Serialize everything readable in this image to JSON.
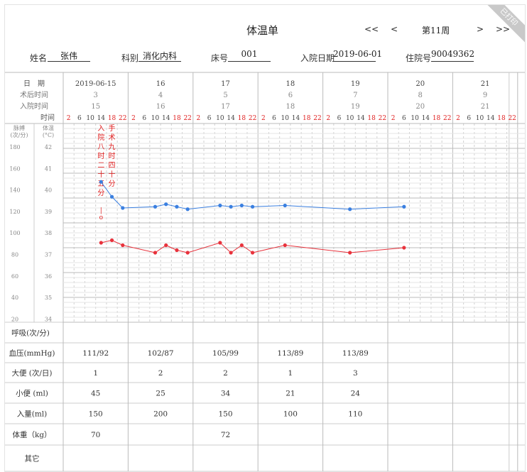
{
  "sheet_title": "体温单",
  "nav": {
    "first": "<<",
    "prev": "<",
    "week": "第11周",
    "next": ">",
    "last": ">>"
  },
  "badge": "已打印",
  "patient": {
    "name_label": "姓名",
    "name": "张伟",
    "dept_label": "科别",
    "dept": "消化内科",
    "bed_label": "床号",
    "bed": "001",
    "admit_label": "入院日期",
    "admit": "2019-06-01",
    "hosp_label": "住院号",
    "hosp": "90049362"
  },
  "row_labels": {
    "date": "日　期",
    "post_op": "术后时间",
    "admit_days": "入院时间",
    "time": "时间",
    "pulse_header": [
      "脉搏",
      "(次/分)"
    ],
    "temp_header": [
      "体温",
      "(°C)"
    ],
    "resp": "呼吸(次/分)",
    "bp": "血压(mmHg)",
    "stool": "大便 (次/日)",
    "urine": "小便 (ml)",
    "intake": "入量(ml)",
    "weight": "体重（kg）",
    "other": "其它"
  },
  "days": [
    {
      "date": "2019-06-15",
      "post_op": "3",
      "admit_day": "15"
    },
    {
      "date": "16",
      "post_op": "4",
      "admit_day": "16"
    },
    {
      "date": "17",
      "post_op": "5",
      "admit_day": "17"
    },
    {
      "date": "18",
      "post_op": "6",
      "admit_day": "18"
    },
    {
      "date": "19",
      "post_op": "7",
      "admit_day": "19"
    },
    {
      "date": "20",
      "post_op": "8",
      "admit_day": "20"
    },
    {
      "date": "21",
      "post_op": "9",
      "admit_day": "21"
    }
  ],
  "time_slots": [
    "2",
    "6",
    "10",
    "14",
    "18",
    "22"
  ],
  "red_slots": [
    "2",
    "18",
    "22"
  ],
  "pulse_scale": [
    "180",
    "160",
    "140",
    "120",
    "100",
    "80",
    "60",
    "40",
    "20"
  ],
  "temp_scale": [
    "42",
    "41",
    "40",
    "39",
    "38",
    "37",
    "36",
    "35",
    "34"
  ],
  "events": [
    {
      "day": 0,
      "slot": 3,
      "text": "入院八时二十五分"
    },
    {
      "day": 0,
      "slot": 4,
      "text": "手术九时四十分"
    }
  ],
  "event_marker": "|",
  "event_dot": "o",
  "colors": {
    "pulse": "#3a7fe0",
    "temp": "#e8323c",
    "red_text": "#e02020",
    "grid": "#cfcfcf"
  },
  "chart_data": {
    "type": "line",
    "series": [
      {
        "points": [
          {
            "day": 0,
            "slot": 3,
            "value": 133
          },
          {
            "day": 0,
            "slot": 4,
            "value": 121
          },
          {
            "day": 0,
            "slot": 5,
            "value": 112
          },
          {
            "day": 1,
            "slot": 2,
            "value": 113
          },
          {
            "day": 1,
            "slot": 3,
            "value": 115
          },
          {
            "day": 1,
            "slot": 4,
            "value": 113
          },
          {
            "day": 1,
            "slot": 5,
            "value": 111
          },
          {
            "day": 2,
            "slot": 2,
            "value": 114
          },
          {
            "day": 2,
            "slot": 3,
            "value": 113
          },
          {
            "day": 2,
            "slot": 4,
            "value": 114
          },
          {
            "day": 2,
            "slot": 5,
            "value": 113
          },
          {
            "day": 3,
            "slot": 2,
            "value": 114
          },
          {
            "day": 4,
            "slot": 2,
            "value": 111
          },
          {
            "day": 5,
            "slot": 1,
            "value": 113
          }
        ]
      },
      {
        "points": [
          {
            "day": 0,
            "slot": 3,
            "value": 37.2
          },
          {
            "day": 0,
            "slot": 4,
            "value": 37.3
          },
          {
            "day": 0,
            "slot": 5,
            "value": 37.1
          },
          {
            "day": 1,
            "slot": 2,
            "value": 36.8
          },
          {
            "day": 1,
            "slot": 3,
            "value": 37.1
          },
          {
            "day": 1,
            "slot": 4,
            "value": 36.9
          },
          {
            "day": 1,
            "slot": 5,
            "value": 36.8
          },
          {
            "day": 2,
            "slot": 2,
            "value": 37.2
          },
          {
            "day": 2,
            "slot": 3,
            "value": 36.8
          },
          {
            "day": 2,
            "slot": 4,
            "value": 37.1
          },
          {
            "day": 2,
            "slot": 5,
            "value": 36.8
          },
          {
            "day": 3,
            "slot": 2,
            "value": 37.1
          },
          {
            "day": 4,
            "slot": 2,
            "value": 36.8
          },
          {
            "day": 5,
            "slot": 1,
            "value": 37.0
          }
        ]
      }
    ],
    "pulse_range": [
      20,
      180
    ],
    "temp_range": [
      34,
      42
    ],
    "grid": true
  },
  "measurements": {
    "bp": [
      "111/92",
      "102/87",
      "105/99",
      "113/89",
      "113/89",
      "",
      ""
    ],
    "stool": [
      "1",
      "2",
      "2",
      "1",
      "3",
      "",
      ""
    ],
    "urine": [
      "45",
      "25",
      "34",
      "21",
      "24",
      "",
      ""
    ],
    "intake": [
      "150",
      "200",
      "150",
      "100",
      "110",
      "",
      ""
    ],
    "weight": [
      "70",
      "",
      "72",
      "",
      "",
      "",
      ""
    ]
  }
}
